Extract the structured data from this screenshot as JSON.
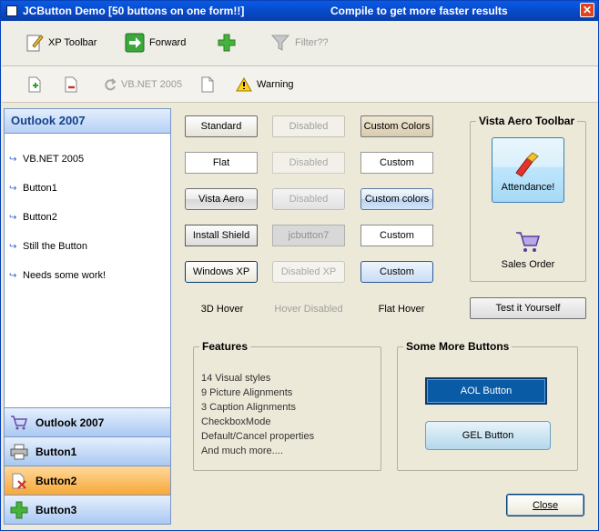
{
  "window": {
    "title": "JCButton Demo  [50 buttons on one form!!]",
    "subtitle": "Compile to get more faster results",
    "close_glyph": "✕"
  },
  "toolbar1": {
    "xp_toolbar": "XP Toolbar",
    "forward": "Forward",
    "filter": "Filter??"
  },
  "toolbar2": {
    "vbnet": "VB.NET 2005",
    "warning": "Warning"
  },
  "sidebar": {
    "header": "Outlook 2007",
    "items": [
      "VB.NET 2005",
      "Button1",
      "Button2",
      "Still the Button",
      "Needs some work!"
    ],
    "buttons": [
      "Outlook 2007",
      "Button1",
      "Button2",
      "Button3"
    ]
  },
  "grid": {
    "col1": [
      "Standard",
      "Flat",
      "Vista Aero",
      "Install Shield",
      "Windows XP"
    ],
    "col2": [
      "Disabled",
      "Disabled",
      "Disabled",
      "jcbutton7",
      "Disabled XP"
    ],
    "col3": [
      "Custom Colors",
      "Custom",
      "Custom colors",
      "Custom",
      "Custom"
    ],
    "hover": [
      "3D Hover",
      "Hover Disabled",
      "Flat Hover"
    ]
  },
  "vista_toolbar": {
    "legend": "Vista Aero Toolbar",
    "attendance": "Attendance!",
    "sales_order": "Sales Order"
  },
  "test_button": "Test it Yourself",
  "features": {
    "legend": "Features",
    "lines": [
      "14 Visual styles",
      "9 Picture Alignments",
      "3 Caption Alignments",
      "CheckboxMode",
      "Default/Cancel properties",
      "And much more...."
    ]
  },
  "more_buttons": {
    "legend": "Some More Buttons",
    "aol": "AOL Button",
    "gel": "GEL Button"
  },
  "close_button": "Close",
  "colors": {
    "title_bar": "#0a5ae6",
    "form_bg": "#ece9d8",
    "sidebar_header": "#15428b",
    "active_outlook": "#f7a838",
    "aol": "#0a5ba6"
  }
}
